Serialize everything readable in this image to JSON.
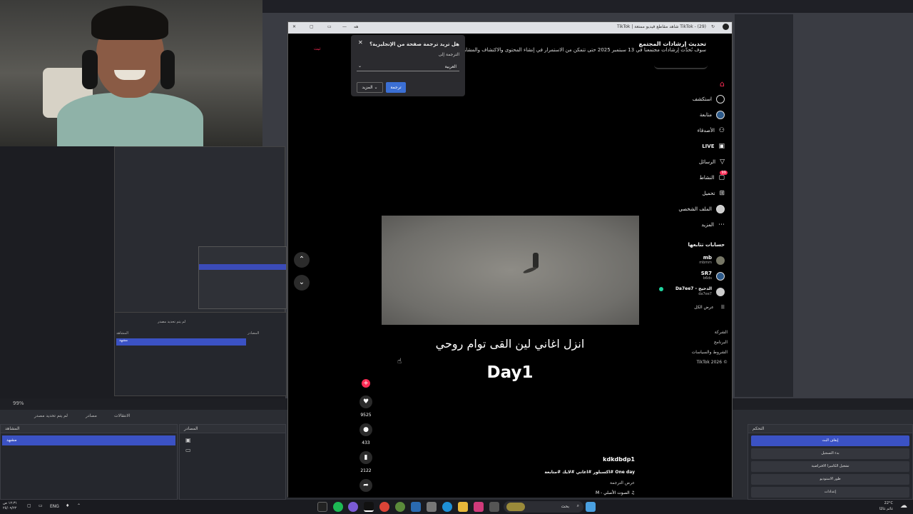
{
  "obs": {
    "zoom": "99%",
    "tabs": [
      "الانتقالات",
      "مصادر",
      "لم يتم تحديد مصدر"
    ],
    "scenes_header": "المشاهد",
    "scene_item": "مشهد",
    "sources_header": "المصادر",
    "controls_header": "التحكم",
    "controls": [
      "إيقاف البث",
      "بدء التسجيل",
      "تشغيل الكاميرا الافتراضية",
      "طور الاستوديو",
      "إعدادات"
    ],
    "nested_tab": "لم يتم تحديد مصدر",
    "nested_scenes": "المشاهد",
    "nested_sources": "المصادر",
    "nested_scene_item": "مشهد"
  },
  "taskbar": {
    "time": "١٢:٣١ ص",
    "date": "٢٥/٠٩/٢٢",
    "lang": "ENG",
    "weather_temp": "22°C",
    "weather_desc": "غائم غالبًا",
    "search": "بحث"
  },
  "browser": {
    "tab_title": "TikTok - (29) شاهد مقاطع فيديو ممتعة | TikTok",
    "address": "هه"
  },
  "popup": {
    "title": "هل تريد ترجمة صفحة من الإنجليزية؟",
    "label": "الترجمة إلى",
    "select": "العربية",
    "translate": "ترجمة",
    "more": "المزيد"
  },
  "banner": {
    "title": "تحديث إرشادات المجتمع",
    "text": "سوف نُحدّث إرشادات مجتمعنا في 13 سبتمبر 2025 حتى تتمكن من الاستمرار في إنشاء المحتوى والاكتشاف والمشاركة",
    "link": "ثبت"
  },
  "nav": {
    "items": [
      {
        "label": "",
        "icon": "home-icon"
      },
      {
        "label": "استكشف",
        "icon": "compass-icon"
      },
      {
        "label": "متابعة",
        "icon": "following-icon"
      },
      {
        "label": "الأصدقاء",
        "icon": "friends-icon"
      },
      {
        "label": "LIVE",
        "icon": "live-icon"
      },
      {
        "label": "الرسائل",
        "icon": "messages-icon"
      },
      {
        "label": "النشاط",
        "icon": "activity-icon"
      },
      {
        "label": "تحميل",
        "icon": "upload-icon"
      },
      {
        "label": "الملف الشخصي",
        "icon": "profile-icon"
      },
      {
        "label": "المزيد",
        "icon": "more-icon"
      }
    ],
    "activity_badge": "99",
    "following_header": "حسابات تتابعها",
    "accounts": [
      {
        "name": "mb",
        "handle": "mbmm"
      },
      {
        "name": "SR7",
        "handle": "b6ds"
      },
      {
        "name": "Da7ee7 - الدحيح",
        "handle": "da7ee7"
      }
    ],
    "see_all": "عرض الكل",
    "footer": [
      "الشركة",
      "البرنامج",
      "الشروط والسياسات",
      "© 2026 TikTok"
    ]
  },
  "video": {
    "caption": "انزل اغاني لين القى توام روحي",
    "overlay": "Day1",
    "likes": "9525",
    "comments": "433",
    "saves": "2122",
    "author": "kdkdbdp1",
    "desc": "One day #اكسبلور #اغاني #لايك #متابعة",
    "translate": "عرض الترجمة",
    "sound": "M - الصوت الأصلي"
  },
  "colors": {
    "accent": "#fe2c55",
    "obs_blue": "#3b52c4",
    "translate_blue": "#3b6fd4"
  }
}
